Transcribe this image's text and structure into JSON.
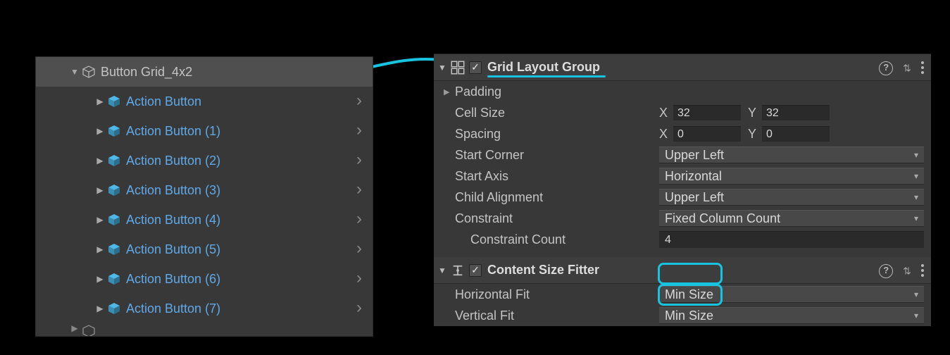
{
  "hierarchy": {
    "parent_label": "Button Grid_4x2",
    "children": [
      {
        "label": "Action Button"
      },
      {
        "label": "Action Button (1)"
      },
      {
        "label": "Action Button (2)"
      },
      {
        "label": "Action Button (3)"
      },
      {
        "label": "Action Button (4)"
      },
      {
        "label": "Action Button (5)"
      },
      {
        "label": "Action Button (6)"
      },
      {
        "label": "Action Button (7)"
      }
    ]
  },
  "inspector": {
    "grid_layout": {
      "title": "Grid Layout Group",
      "enabled": true,
      "padding_label": "Padding",
      "cell_size_label": "Cell Size",
      "cell_size_x": "32",
      "cell_size_y": "32",
      "spacing_label": "Spacing",
      "spacing_x": "0",
      "spacing_y": "0",
      "start_corner_label": "Start Corner",
      "start_corner_value": "Upper Left",
      "start_axis_label": "Start Axis",
      "start_axis_value": "Horizontal",
      "child_alignment_label": "Child Alignment",
      "child_alignment_value": "Upper Left",
      "constraint_label": "Constraint",
      "constraint_value": "Fixed Column Count",
      "constraint_count_label": "Constraint Count",
      "constraint_count_value": "4"
    },
    "content_size_fitter": {
      "title": "Content Size Fitter",
      "enabled": true,
      "h_fit_label": "Horizontal Fit",
      "h_fit_value": "Min Size",
      "v_fit_label": "Vertical Fit",
      "v_fit_value": "Min Size"
    }
  },
  "axis": {
    "x": "X",
    "y": "Y"
  },
  "colors": {
    "accent": "#18c3e0",
    "prefab": "#5fa9e8"
  }
}
